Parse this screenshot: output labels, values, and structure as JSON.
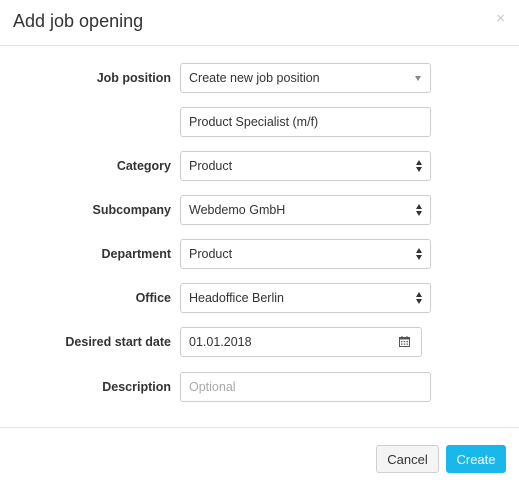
{
  "modal": {
    "title": "Add job opening",
    "close_glyph": "×"
  },
  "form": {
    "job_position": {
      "label": "Job position",
      "value": "Create new job position",
      "control": "dropdown"
    },
    "position_name": {
      "value": "Product Specialist (m/f)"
    },
    "category": {
      "label": "Category",
      "value": "Product"
    },
    "subcompany": {
      "label": "Subcompany",
      "value": "Webdemo GmbH"
    },
    "department": {
      "label": "Department",
      "value": "Product"
    },
    "office": {
      "label": "Office",
      "value": "Headoffice Berlin"
    },
    "start_date": {
      "label": "Desired start date",
      "value": "01.01.2018",
      "icon": "calendar-icon"
    },
    "description": {
      "label": "Description",
      "placeholder": "Optional"
    }
  },
  "footer": {
    "cancel_label": "Cancel",
    "create_label": "Create"
  },
  "colors": {
    "primary": "#19b7ea",
    "border": "#cccccc"
  }
}
